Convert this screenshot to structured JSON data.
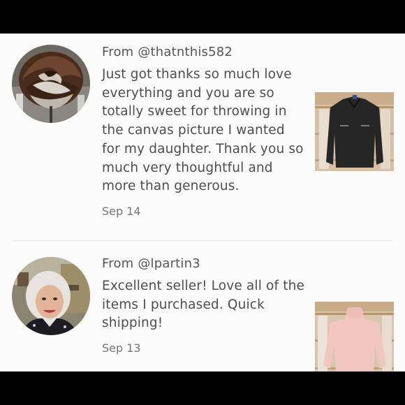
{
  "reviews": [
    {
      "from": "From @thatnthis582",
      "message": "Just got thanks so much love everything and you are so totally sweet for throwing in the canvas picture I wanted for my daughter. Thank you so much very thoughtful and more than generous.",
      "date": "Sep 14",
      "avatar_icon": "rose-photo",
      "item_icon": "black-blouse-photo"
    },
    {
      "from": "From @lpartin3",
      "message": "Excellent seller! Love all of the items I purchased. Quick shipping!",
      "date": "Sep 13",
      "avatar_icon": "woman-portrait-photo",
      "item_icon": "pink-turtleneck-photo"
    }
  ],
  "colors": {
    "background": "#fbfbfb",
    "text": "#4e4e4e",
    "muted": "#777777",
    "divider": "#e6e6e6"
  }
}
